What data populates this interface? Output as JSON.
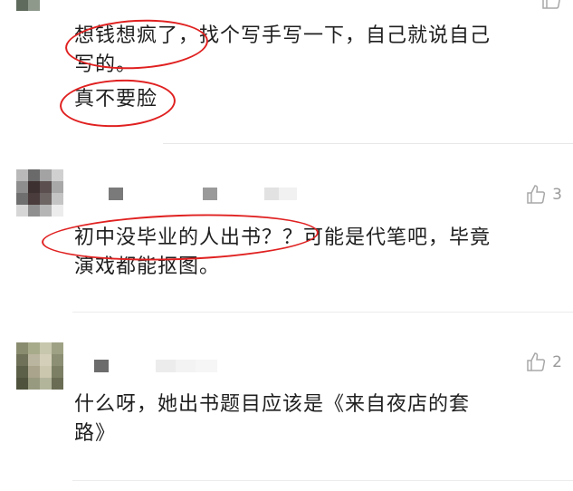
{
  "comments": [
    {
      "lines": [
        "想钱想疯了，找个写手写一下，自己就说自己",
        "写的。",
        "真不要脸"
      ]
    },
    {
      "like_count": "3",
      "lines": [
        "初中没毕业的人出书？？可能是代笔吧，毕竟",
        "演戏都能抠图。"
      ]
    },
    {
      "like_count": "2",
      "lines": [
        "什么呀，她出书题目应该是《来自夜店的套",
        "路》"
      ]
    }
  ],
  "icons": {
    "like": "thumbs-up-icon"
  },
  "colors": {
    "annotation": "#e02020",
    "muted": "#9a9a9a",
    "text": "#1f1f1f"
  }
}
